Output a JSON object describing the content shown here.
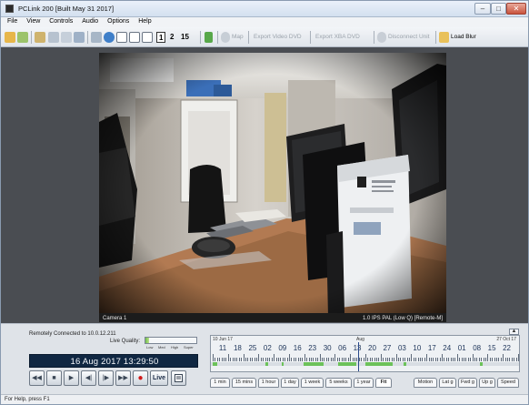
{
  "window": {
    "title": "PCLink 200 [Built May 31 2017]",
    "minimize_glyph": "–",
    "maximize_glyph": "□",
    "close_glyph": "✕"
  },
  "menu": [
    "File",
    "View",
    "Controls",
    "Audio",
    "Options",
    "Help"
  ],
  "toolbar": {
    "layout_numbers": [
      "1",
      "2",
      "15"
    ],
    "map_label": "Map",
    "export_video_label": "Export Video DVD",
    "export_xba_label": "Export XBA DVD",
    "disconnect_label": "Disconnect Unit",
    "load_blur_label": "Load Blur"
  },
  "video": {
    "camera_label": "Camera 1",
    "stream_info": "1.0 IPS PAL (Low Q) [Remote-M]"
  },
  "controls": {
    "connection_text": "Remotely Connected to 10.0.12.211",
    "quality_label": "Live Quality:",
    "quality_level": 0.08,
    "quality_scale": [
      "Low",
      "Med",
      "High",
      "Super"
    ],
    "datetime": "16 Aug 2017  13:29:50",
    "transport_glyphs": [
      "◀◀",
      "■",
      "▶",
      "◀|",
      "|▶",
      "▶▶",
      "●"
    ],
    "live_label": "Live"
  },
  "timeline": {
    "start_date": "10 Jun 17",
    "now_marker": "Aug",
    "end_date": "27 Oct 17",
    "days": [
      "11",
      "18",
      "25",
      "02",
      "09",
      "16",
      "23",
      "30",
      "06",
      "13",
      "20",
      "27",
      "03",
      "10",
      "17",
      "24",
      "01",
      "08",
      "15",
      "22"
    ],
    "zoom_tabs": [
      "1 min",
      "15 mins",
      "1 hour",
      "1 day",
      "1 week",
      "5 weeks",
      "1 year",
      "Fit"
    ],
    "filter_tabs": [
      "Motion",
      "Lat g",
      "Fwd g",
      "Up g",
      "Speed"
    ],
    "scroll_glyph": "▲"
  },
  "status": {
    "text": "For Help, press F1"
  },
  "colors": {
    "datetime_bg": "#102742",
    "recording_segment": "#6cc25a"
  }
}
